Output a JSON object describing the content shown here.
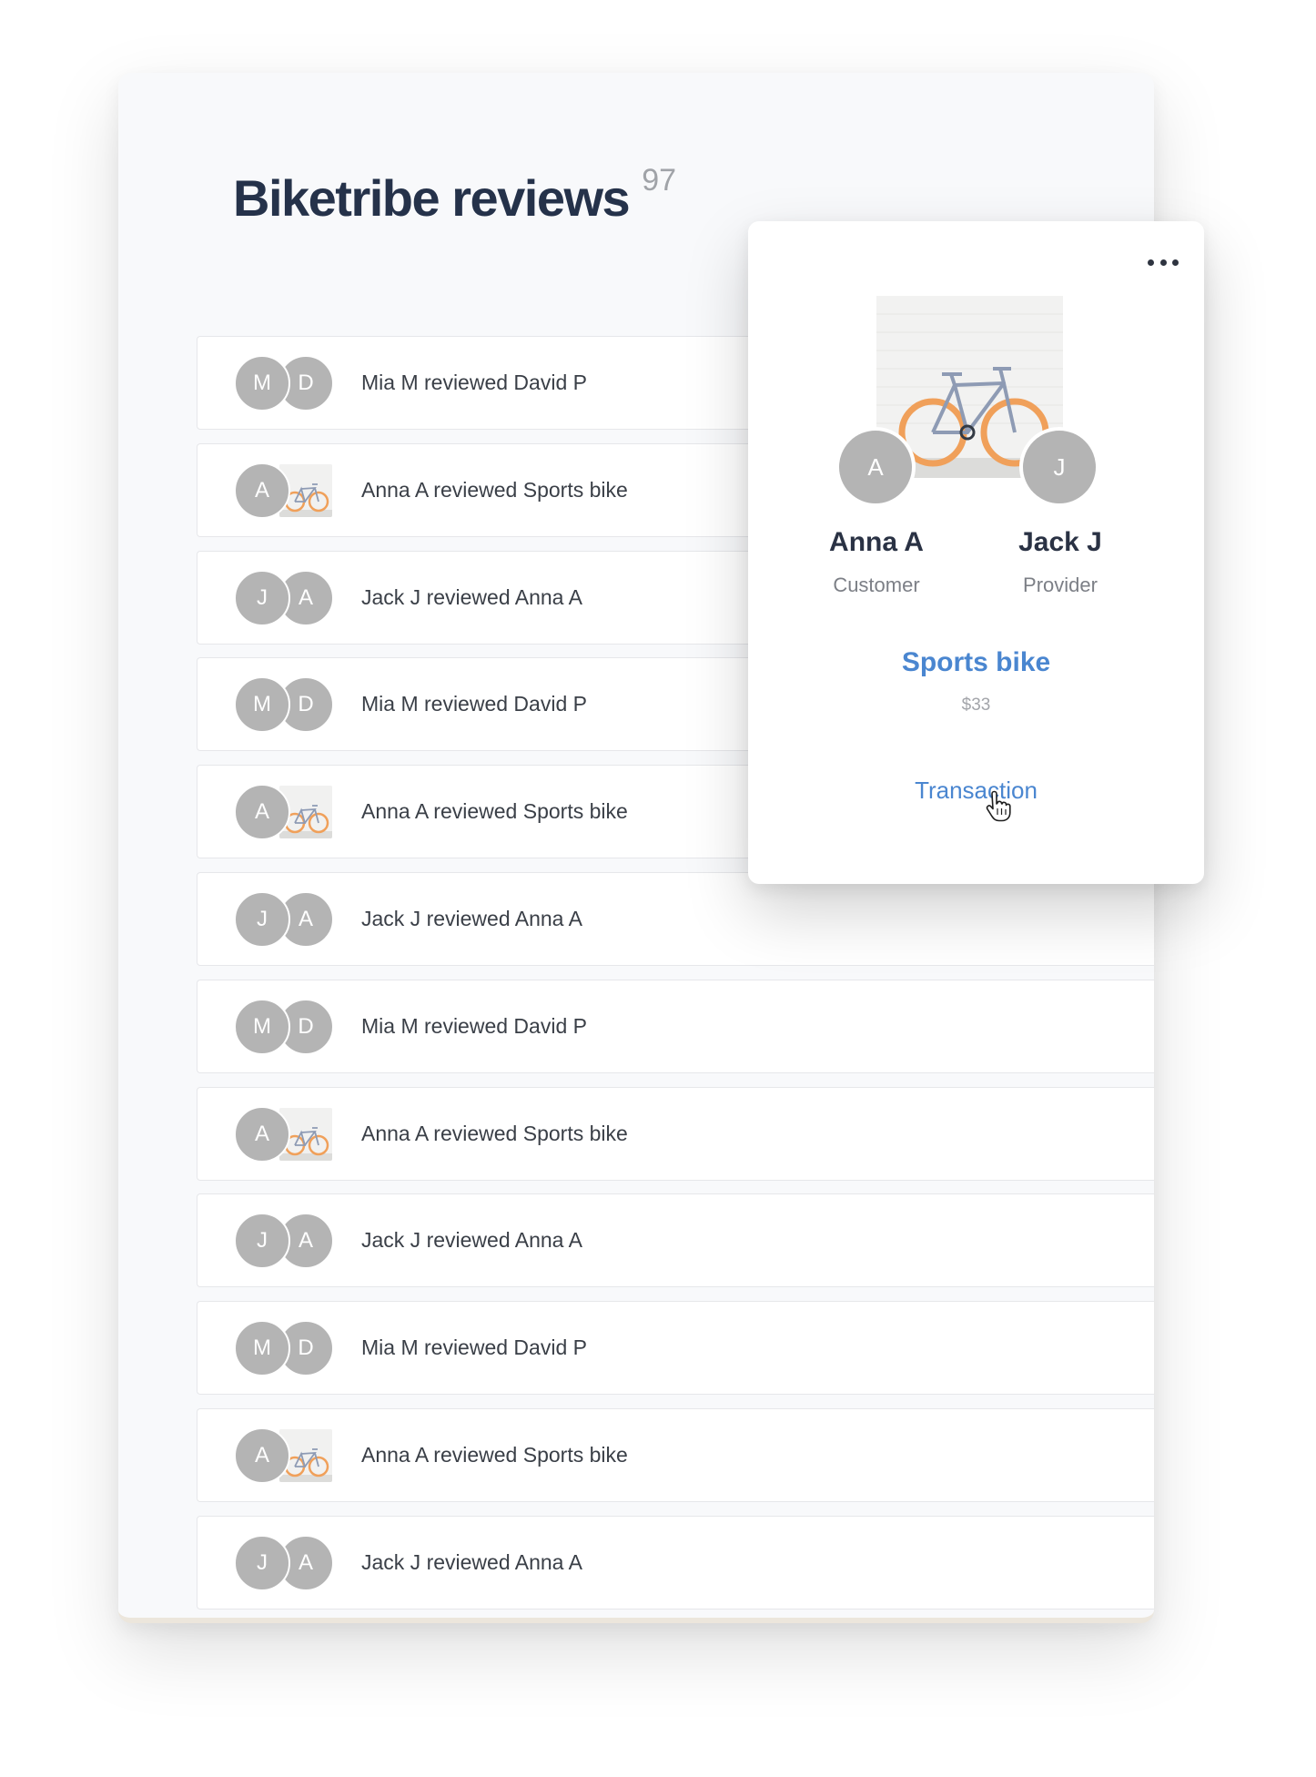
{
  "header": {
    "title": "Biketribe reviews",
    "count": "97"
  },
  "reviews": [
    {
      "initial_1": "M",
      "initial_2": "D",
      "text": "Mia M reviewed David P",
      "kind": "user"
    },
    {
      "initial_1": "A",
      "text": "Anna A reviewed Sports bike",
      "kind": "listing"
    },
    {
      "initial_1": "J",
      "initial_2": "A",
      "text": "Jack J reviewed Anna A",
      "kind": "user"
    },
    {
      "initial_1": "M",
      "initial_2": "D",
      "text": "Mia M reviewed David P",
      "kind": "user"
    },
    {
      "initial_1": "A",
      "text": "Anna A reviewed Sports bike",
      "kind": "listing"
    },
    {
      "initial_1": "J",
      "initial_2": "A",
      "text": "Jack J reviewed Anna A",
      "kind": "user"
    },
    {
      "initial_1": "M",
      "initial_2": "D",
      "text": "Mia M reviewed David P",
      "kind": "user"
    },
    {
      "initial_1": "A",
      "text": "Anna A reviewed Sports bike",
      "kind": "listing"
    },
    {
      "initial_1": "J",
      "initial_2": "A",
      "text": "Jack J reviewed Anna A",
      "kind": "user"
    },
    {
      "initial_1": "M",
      "initial_2": "D",
      "text": "Mia M reviewed David P",
      "kind": "user"
    },
    {
      "initial_1": "A",
      "text": "Anna A reviewed Sports bike",
      "kind": "listing"
    },
    {
      "initial_1": "J",
      "initial_2": "A",
      "text": "Jack J reviewed Anna A",
      "kind": "user"
    }
  ],
  "popup": {
    "menu_icon": "more-horizontal-icon",
    "customer": {
      "initial": "A",
      "name": "Anna A",
      "role": "Customer"
    },
    "provider": {
      "initial": "J",
      "name": "Jack J",
      "role": "Provider"
    },
    "listing": {
      "title": "Sports bike",
      "price": "$33"
    },
    "transaction_link": "Transaction",
    "cursor_icon": "hand-pointer-icon"
  },
  "colors": {
    "title": "#25324a",
    "link": "#4a86d0",
    "avatar": "#b4b4b4",
    "bike_frame": "#8e9bb4",
    "bike_tire": "#f0a05a"
  }
}
